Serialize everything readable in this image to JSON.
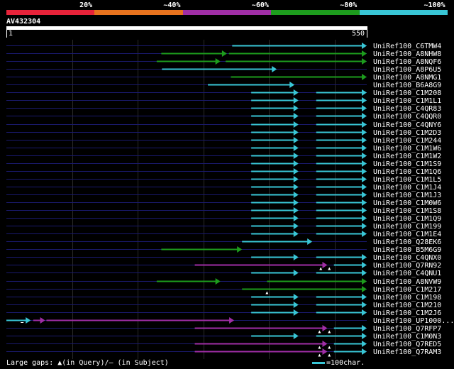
{
  "identity_legend": [
    {
      "label": "20%",
      "color": "#e8233a"
    },
    {
      "label": "~40%",
      "color": "#e8731e"
    },
    {
      "label": "~60%",
      "color": "#a02ea6"
    },
    {
      "label": "~80%",
      "color": "#1d9c1d"
    },
    {
      "label": "~100%",
      "color": "#39c6d6"
    }
  ],
  "query": {
    "name": "AV432304",
    "start_label": "1",
    "end_label": "550",
    "length": 550
  },
  "footer": {
    "gaps_text": "Large gaps: ▲(in Query)/– (in Subject)",
    "scale_text": "=100char."
  },
  "hits": [
    {
      "name": "UniRef100_C6TMW4",
      "segments": [
        [
          345,
          550,
          "cyan"
        ]
      ]
    },
    {
      "name": "UniRef100_A8NHW8",
      "segments": [
        [
          237,
          337,
          "green"
        ],
        [
          340,
          550,
          "green"
        ]
      ]
    },
    {
      "name": "UniRef100_A8NQF6",
      "segments": [
        [
          230,
          327,
          "green"
        ],
        [
          335,
          550,
          "green"
        ]
      ]
    },
    {
      "name": "UniRef100_A8P6U5",
      "segments": [
        [
          238,
          413,
          "cyan"
        ]
      ]
    },
    {
      "name": "UniRef100_A8NMG1",
      "segments": [
        [
          343,
          550,
          "green"
        ]
      ]
    },
    {
      "name": "UniRef100_B6A8G9",
      "segments": [
        [
          308,
          440,
          "cyan"
        ]
      ]
    },
    {
      "name": "UniRef100_C1M208",
      "segments": [
        [
          374,
          446,
          "cyan"
        ],
        [
          473,
          550,
          "cyan"
        ]
      ]
    },
    {
      "name": "UniRef100_C1M1L1",
      "segments": [
        [
          374,
          446,
          "cyan"
        ],
        [
          473,
          550,
          "cyan"
        ]
      ]
    },
    {
      "name": "UniRef100_C4QR83",
      "segments": [
        [
          374,
          446,
          "cyan"
        ],
        [
          473,
          550,
          "cyan"
        ]
      ]
    },
    {
      "name": "UniRef100_C4QQR0",
      "segments": [
        [
          374,
          446,
          "cyan"
        ],
        [
          473,
          550,
          "cyan"
        ]
      ]
    },
    {
      "name": "UniRef100_C4QNY6",
      "segments": [
        [
          374,
          446,
          "cyan"
        ],
        [
          473,
          550,
          "cyan"
        ]
      ]
    },
    {
      "name": "UniRef100_C1M2D3",
      "segments": [
        [
          374,
          446,
          "cyan"
        ],
        [
          473,
          550,
          "cyan"
        ]
      ]
    },
    {
      "name": "UniRef100_C1M244",
      "segments": [
        [
          374,
          446,
          "cyan"
        ],
        [
          473,
          550,
          "cyan"
        ]
      ]
    },
    {
      "name": "UniRef100_C1M1W6",
      "segments": [
        [
          374,
          446,
          "cyan"
        ],
        [
          473,
          550,
          "cyan"
        ]
      ]
    },
    {
      "name": "UniRef100_C1M1W2",
      "segments": [
        [
          374,
          446,
          "cyan"
        ],
        [
          473,
          550,
          "cyan"
        ]
      ]
    },
    {
      "name": "UniRef100_C1M1S9",
      "segments": [
        [
          374,
          446,
          "cyan"
        ],
        [
          473,
          550,
          "cyan"
        ]
      ]
    },
    {
      "name": "UniRef100_C1M1Q6",
      "segments": [
        [
          374,
          446,
          "cyan"
        ],
        [
          473,
          550,
          "cyan"
        ]
      ]
    },
    {
      "name": "UniRef100_C1M1L5",
      "segments": [
        [
          374,
          446,
          "cyan"
        ],
        [
          473,
          550,
          "cyan"
        ]
      ]
    },
    {
      "name": "UniRef100_C1M1J4",
      "segments": [
        [
          374,
          446,
          "cyan"
        ],
        [
          473,
          550,
          "cyan"
        ]
      ]
    },
    {
      "name": "UniRef100_C1M1J3",
      "segments": [
        [
          374,
          446,
          "cyan"
        ],
        [
          473,
          550,
          "cyan"
        ]
      ]
    },
    {
      "name": "UniRef100_C1M0W6",
      "segments": [
        [
          374,
          446,
          "cyan"
        ],
        [
          473,
          550,
          "cyan"
        ]
      ]
    },
    {
      "name": "UniRef100_C1M1S8",
      "segments": [
        [
          374,
          446,
          "cyan"
        ],
        [
          473,
          550,
          "cyan"
        ]
      ]
    },
    {
      "name": "UniRef100_C1M1Q9",
      "segments": [
        [
          374,
          446,
          "cyan"
        ],
        [
          473,
          550,
          "cyan"
        ]
      ]
    },
    {
      "name": "UniRef100_C1M199",
      "segments": [
        [
          374,
          446,
          "cyan"
        ],
        [
          473,
          550,
          "cyan"
        ]
      ]
    },
    {
      "name": "UniRef100_C1M1E4",
      "segments": [
        [
          374,
          446,
          "cyan"
        ],
        [
          473,
          550,
          "cyan"
        ]
      ]
    },
    {
      "name": "UniRef100_Q28EK6",
      "segments": [
        [
          360,
          467,
          "cyan"
        ]
      ]
    },
    {
      "name": "UniRef100_B5M6G9",
      "segments": [
        [
          237,
          360,
          "green"
        ]
      ]
    },
    {
      "name": "UniRef100_C4QNX0",
      "segments": [
        [
          374,
          446,
          "cyan"
        ],
        [
          473,
          550,
          "cyan"
        ]
      ]
    },
    {
      "name": "UniRef100_Q7RN92",
      "segments": [
        [
          288,
          490,
          "purple"
        ],
        [
          500,
          550,
          "cyan"
        ]
      ],
      "markers": [
        [
          480,
          "query"
        ],
        [
          493,
          "query"
        ]
      ]
    },
    {
      "name": "UniRef100_C4QNU1",
      "segments": [
        [
          374,
          446,
          "cyan"
        ],
        [
          473,
          550,
          "cyan"
        ]
      ]
    },
    {
      "name": "UniRef100_A8NVW9",
      "segments": [
        [
          230,
          327,
          "green"
        ],
        [
          398,
          550,
          "green"
        ]
      ]
    },
    {
      "name": "UniRef100_C1M217",
      "segments": [
        [
          360,
          550,
          "green"
        ]
      ],
      "markers": [
        [
          398,
          "query"
        ]
      ]
    },
    {
      "name": "UniRef100_C1M198",
      "segments": [
        [
          374,
          446,
          "cyan"
        ],
        [
          473,
          550,
          "cyan"
        ]
      ]
    },
    {
      "name": "UniRef100_C1M210",
      "segments": [
        [
          374,
          446,
          "cyan"
        ],
        [
          473,
          550,
          "cyan"
        ]
      ]
    },
    {
      "name": "UniRef100_C1M2J6",
      "segments": [
        [
          374,
          446,
          "cyan"
        ],
        [
          473,
          550,
          "cyan"
        ]
      ]
    },
    {
      "name": "UniRef100_UP1000...",
      "segments": [
        [
          1,
          38,
          "cyan"
        ],
        [
          42,
          60,
          "purple"
        ],
        [
          62,
          348,
          "purple"
        ]
      ],
      "markers": [
        [
          25,
          "subject"
        ]
      ]
    },
    {
      "name": "UniRef100_Q7RFP7",
      "segments": [
        [
          288,
          490,
          "purple"
        ],
        [
          500,
          550,
          "cyan"
        ]
      ],
      "markers": [
        [
          478,
          "query"
        ],
        [
          493,
          "query"
        ]
      ]
    },
    {
      "name": "UniRef100_C1M0N3",
      "segments": [
        [
          374,
          446,
          "cyan"
        ],
        [
          473,
          550,
          "cyan"
        ]
      ]
    },
    {
      "name": "UniRef100_Q7RED5",
      "segments": [
        [
          288,
          490,
          "purple"
        ],
        [
          500,
          550,
          "cyan"
        ]
      ],
      "markers": [
        [
          478,
          "query"
        ],
        [
          493,
          "query"
        ]
      ]
    },
    {
      "name": "UniRef100_Q7RAM3",
      "segments": [
        [
          288,
          490,
          "purple"
        ],
        [
          500,
          550,
          "cyan"
        ]
      ],
      "markers": [
        [
          478,
          "query"
        ],
        [
          493,
          "query"
        ]
      ]
    }
  ]
}
